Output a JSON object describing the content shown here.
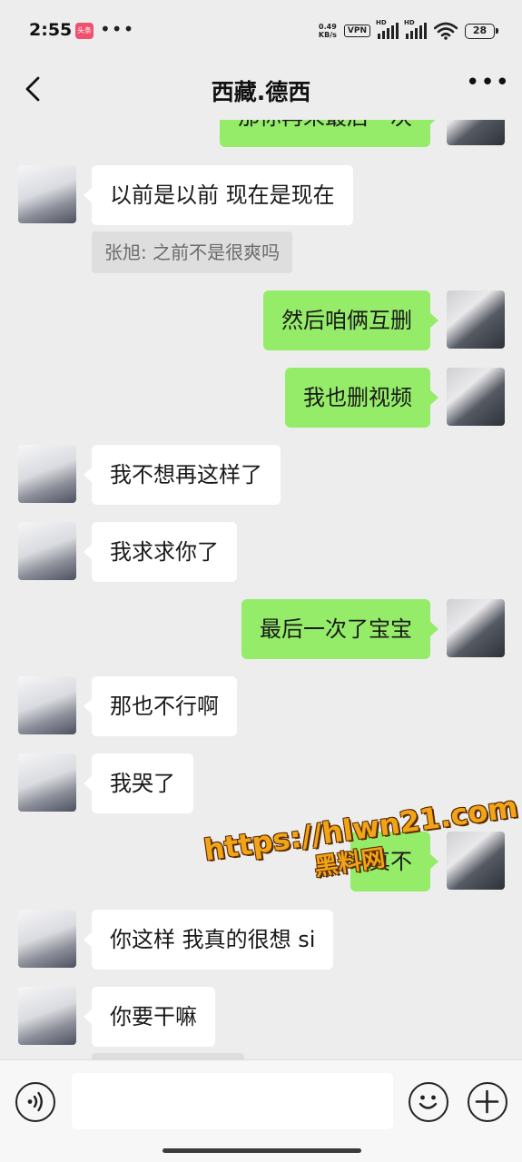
{
  "status_bar": {
    "time": "2:55",
    "app_badge": "头条",
    "dots": "•••",
    "net_speed_value": "0.49",
    "net_speed_unit": "KB/s",
    "vpn": "VPN",
    "hd_label": "HD",
    "battery": "28"
  },
  "nav": {
    "title": "西藏.德西",
    "more": "•••"
  },
  "messages": [
    {
      "side": "right",
      "text": "那你再来最后一次"
    },
    {
      "side": "left",
      "text": "以前是以前 现在是现在"
    },
    {
      "side": "quote",
      "text": "张旭: 之前不是很爽吗"
    },
    {
      "side": "right",
      "text": "然后咱俩互删"
    },
    {
      "side": "right",
      "text": "我也删视频"
    },
    {
      "side": "left",
      "text": "我不想再这样了"
    },
    {
      "side": "left",
      "text": "我求求你了"
    },
    {
      "side": "right",
      "text": "最后一次了宝宝"
    },
    {
      "side": "left",
      "text": "那也不行啊"
    },
    {
      "side": "left",
      "text": "我哭了"
    },
    {
      "side": "right",
      "text": "真不"
    },
    {
      "side": "left",
      "text": "你这样 我真的很想 si"
    },
    {
      "side": "left",
      "text": "你要干嘛"
    }
  ],
  "watermark": {
    "url": "https://hlwn21.com",
    "subtitle": "黑料网"
  },
  "colors": {
    "background": "#ededed",
    "bubble_self": "#95ec69",
    "bubble_other": "#ffffff"
  },
  "icons": {
    "back": "chevron-left",
    "more": "ellipsis",
    "voice": "voice-wave",
    "emoji": "smiley",
    "add": "plus"
  }
}
